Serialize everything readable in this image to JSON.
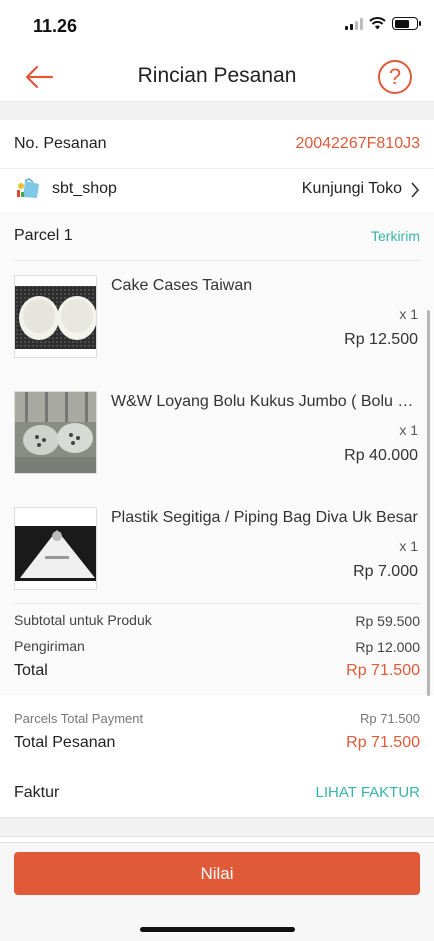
{
  "status_bar": {
    "time": "11.26"
  },
  "header": {
    "title": "Rincian Pesanan",
    "help_symbol": "?",
    "back_icon": "arrow-left-icon"
  },
  "order": {
    "label": "No. Pesanan",
    "number": "20042267F810J3"
  },
  "shop": {
    "name": "sbt_shop",
    "visit_label": "Kunjungi Toko",
    "icon": "shop-avatar-icon"
  },
  "parcel": {
    "label": "Parcel 1",
    "status": "Terkirim"
  },
  "products": [
    {
      "name": "Cake Cases Taiwan",
      "qty": "x 1",
      "price": "Rp 12.500"
    },
    {
      "name": "W&W Loyang Bolu Kukus Jumbo ( Bolu Kukus Mekar )",
      "qty": "x 1",
      "price": "Rp 40.000"
    },
    {
      "name": "Plastik Segitiga / Piping Bag Diva Uk Besar",
      "qty": "x 1",
      "price": "Rp 7.000"
    }
  ],
  "summary": {
    "subtotal_label": "Subtotal untuk Produk",
    "subtotal_value": "Rp 59.500",
    "shipping_label": "Pengiriman",
    "shipping_value": "Rp 12.000",
    "total_label": "Total",
    "total_value": "Rp 71.500"
  },
  "payment": {
    "parcels_label": "Parcels Total Payment",
    "parcels_value": "Rp 71.500",
    "order_total_label": "Total Pesanan",
    "order_total_value": "Rp 71.500"
  },
  "invoice": {
    "label": "Faktur",
    "link": "LIHAT FAKTUR"
  },
  "footer": {
    "button": "Nilai"
  },
  "colors": {
    "accent": "#e05a3a",
    "status": "#38b5a8"
  }
}
